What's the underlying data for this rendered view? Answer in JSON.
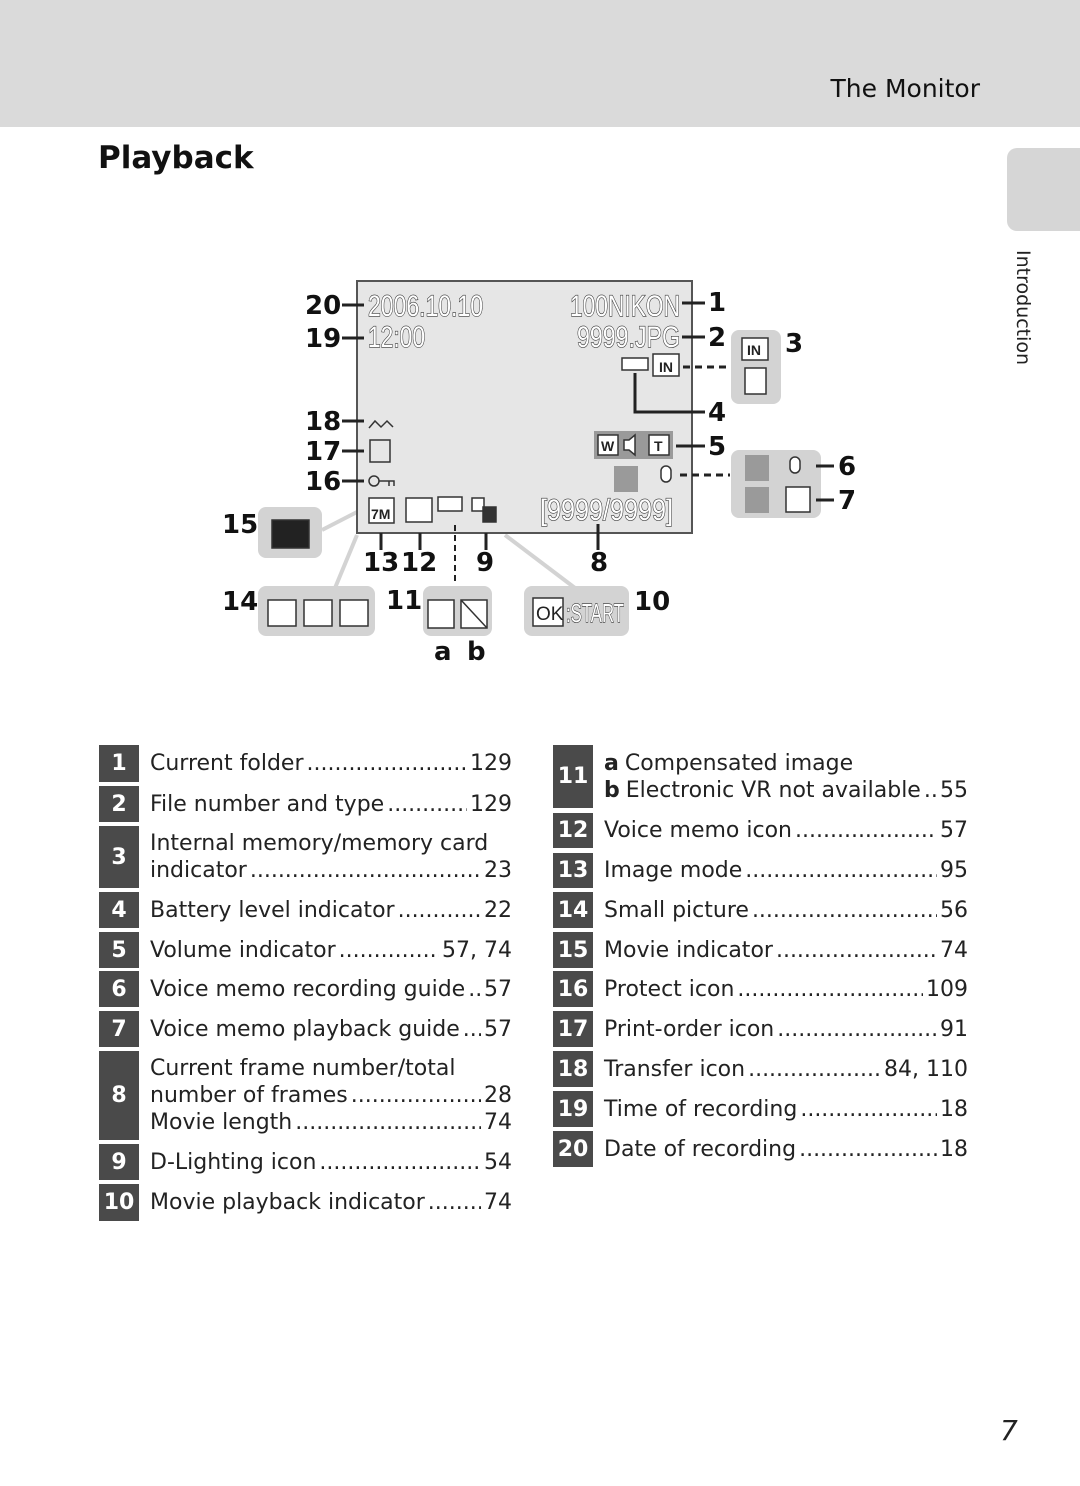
{
  "header": {
    "section": "The Monitor"
  },
  "page_title": "Playback",
  "side_tab": "Introduction",
  "page_number": "7",
  "diagram": {
    "screen": {
      "date": "2006.10.10",
      "time": "12:00",
      "folder": "100NIKON",
      "file": "9999.JPG",
      "frames": "[9999/9999]",
      "image_mode": "7M",
      "wide": "W",
      "tele": "T",
      "internal": "IN",
      "ok": "OK",
      "start": ":START"
    },
    "callouts": [
      "1",
      "2",
      "3",
      "4",
      "5",
      "6",
      "7",
      "8",
      "9",
      "10",
      "11",
      "12",
      "13",
      "14",
      "15",
      "16",
      "17",
      "18",
      "19",
      "20"
    ],
    "sub_a": "a",
    "sub_b": "b"
  },
  "legend_left": [
    {
      "n": "1",
      "lines": [
        {
          "text": "Current folder",
          "page": "129"
        }
      ]
    },
    {
      "n": "2",
      "lines": [
        {
          "text": "File number and type",
          "page": "129"
        }
      ]
    },
    {
      "n": "3",
      "lines": [
        {
          "text": "Internal memory/memory card"
        },
        {
          "text": "indicator",
          "page": "23"
        }
      ]
    },
    {
      "n": "4",
      "lines": [
        {
          "text": "Battery level indicator",
          "page": "22"
        }
      ]
    },
    {
      "n": "5",
      "lines": [
        {
          "text": "Volume indicator",
          "page": "57, 74"
        }
      ]
    },
    {
      "n": "6",
      "lines": [
        {
          "text": "Voice memo recording guide",
          "page": "57"
        }
      ]
    },
    {
      "n": "7",
      "lines": [
        {
          "text": "Voice memo playback guide",
          "page": "57"
        }
      ]
    },
    {
      "n": "8",
      "lines": [
        {
          "text": "Current frame number/total"
        },
        {
          "text": "number of frames",
          "page": "28"
        },
        {
          "text": "Movie length",
          "page": "74"
        }
      ]
    },
    {
      "n": "9",
      "lines": [
        {
          "text": "D-Lighting icon",
          "page": "54"
        }
      ]
    },
    {
      "n": "10",
      "lines": [
        {
          "text": "Movie playback indicator",
          "page": "74"
        }
      ]
    }
  ],
  "legend_right": [
    {
      "n": "11",
      "lines": [
        {
          "prefix": "a",
          "text": "Compensated image"
        },
        {
          "prefix": "b",
          "text": "Electronic VR not available",
          "page": "55"
        }
      ]
    },
    {
      "n": "12",
      "lines": [
        {
          "text": "Voice memo icon",
          "page": "57"
        }
      ]
    },
    {
      "n": "13",
      "lines": [
        {
          "text": "Image mode",
          "page": "95"
        }
      ]
    },
    {
      "n": "14",
      "lines": [
        {
          "text": "Small picture",
          "page": "56"
        }
      ]
    },
    {
      "n": "15",
      "lines": [
        {
          "text": "Movie indicator",
          "page": "74"
        }
      ]
    },
    {
      "n": "16",
      "lines": [
        {
          "text": "Protect icon",
          "page": "109"
        }
      ]
    },
    {
      "n": "17",
      "lines": [
        {
          "text": "Print-order icon",
          "page": "91"
        }
      ]
    },
    {
      "n": "18",
      "lines": [
        {
          "text": "Transfer icon",
          "page": "84, 110"
        }
      ]
    },
    {
      "n": "19",
      "lines": [
        {
          "text": "Time of recording",
          "page": "18"
        }
      ]
    },
    {
      "n": "20",
      "lines": [
        {
          "text": "Date of recording",
          "page": "18"
        }
      ]
    }
  ]
}
